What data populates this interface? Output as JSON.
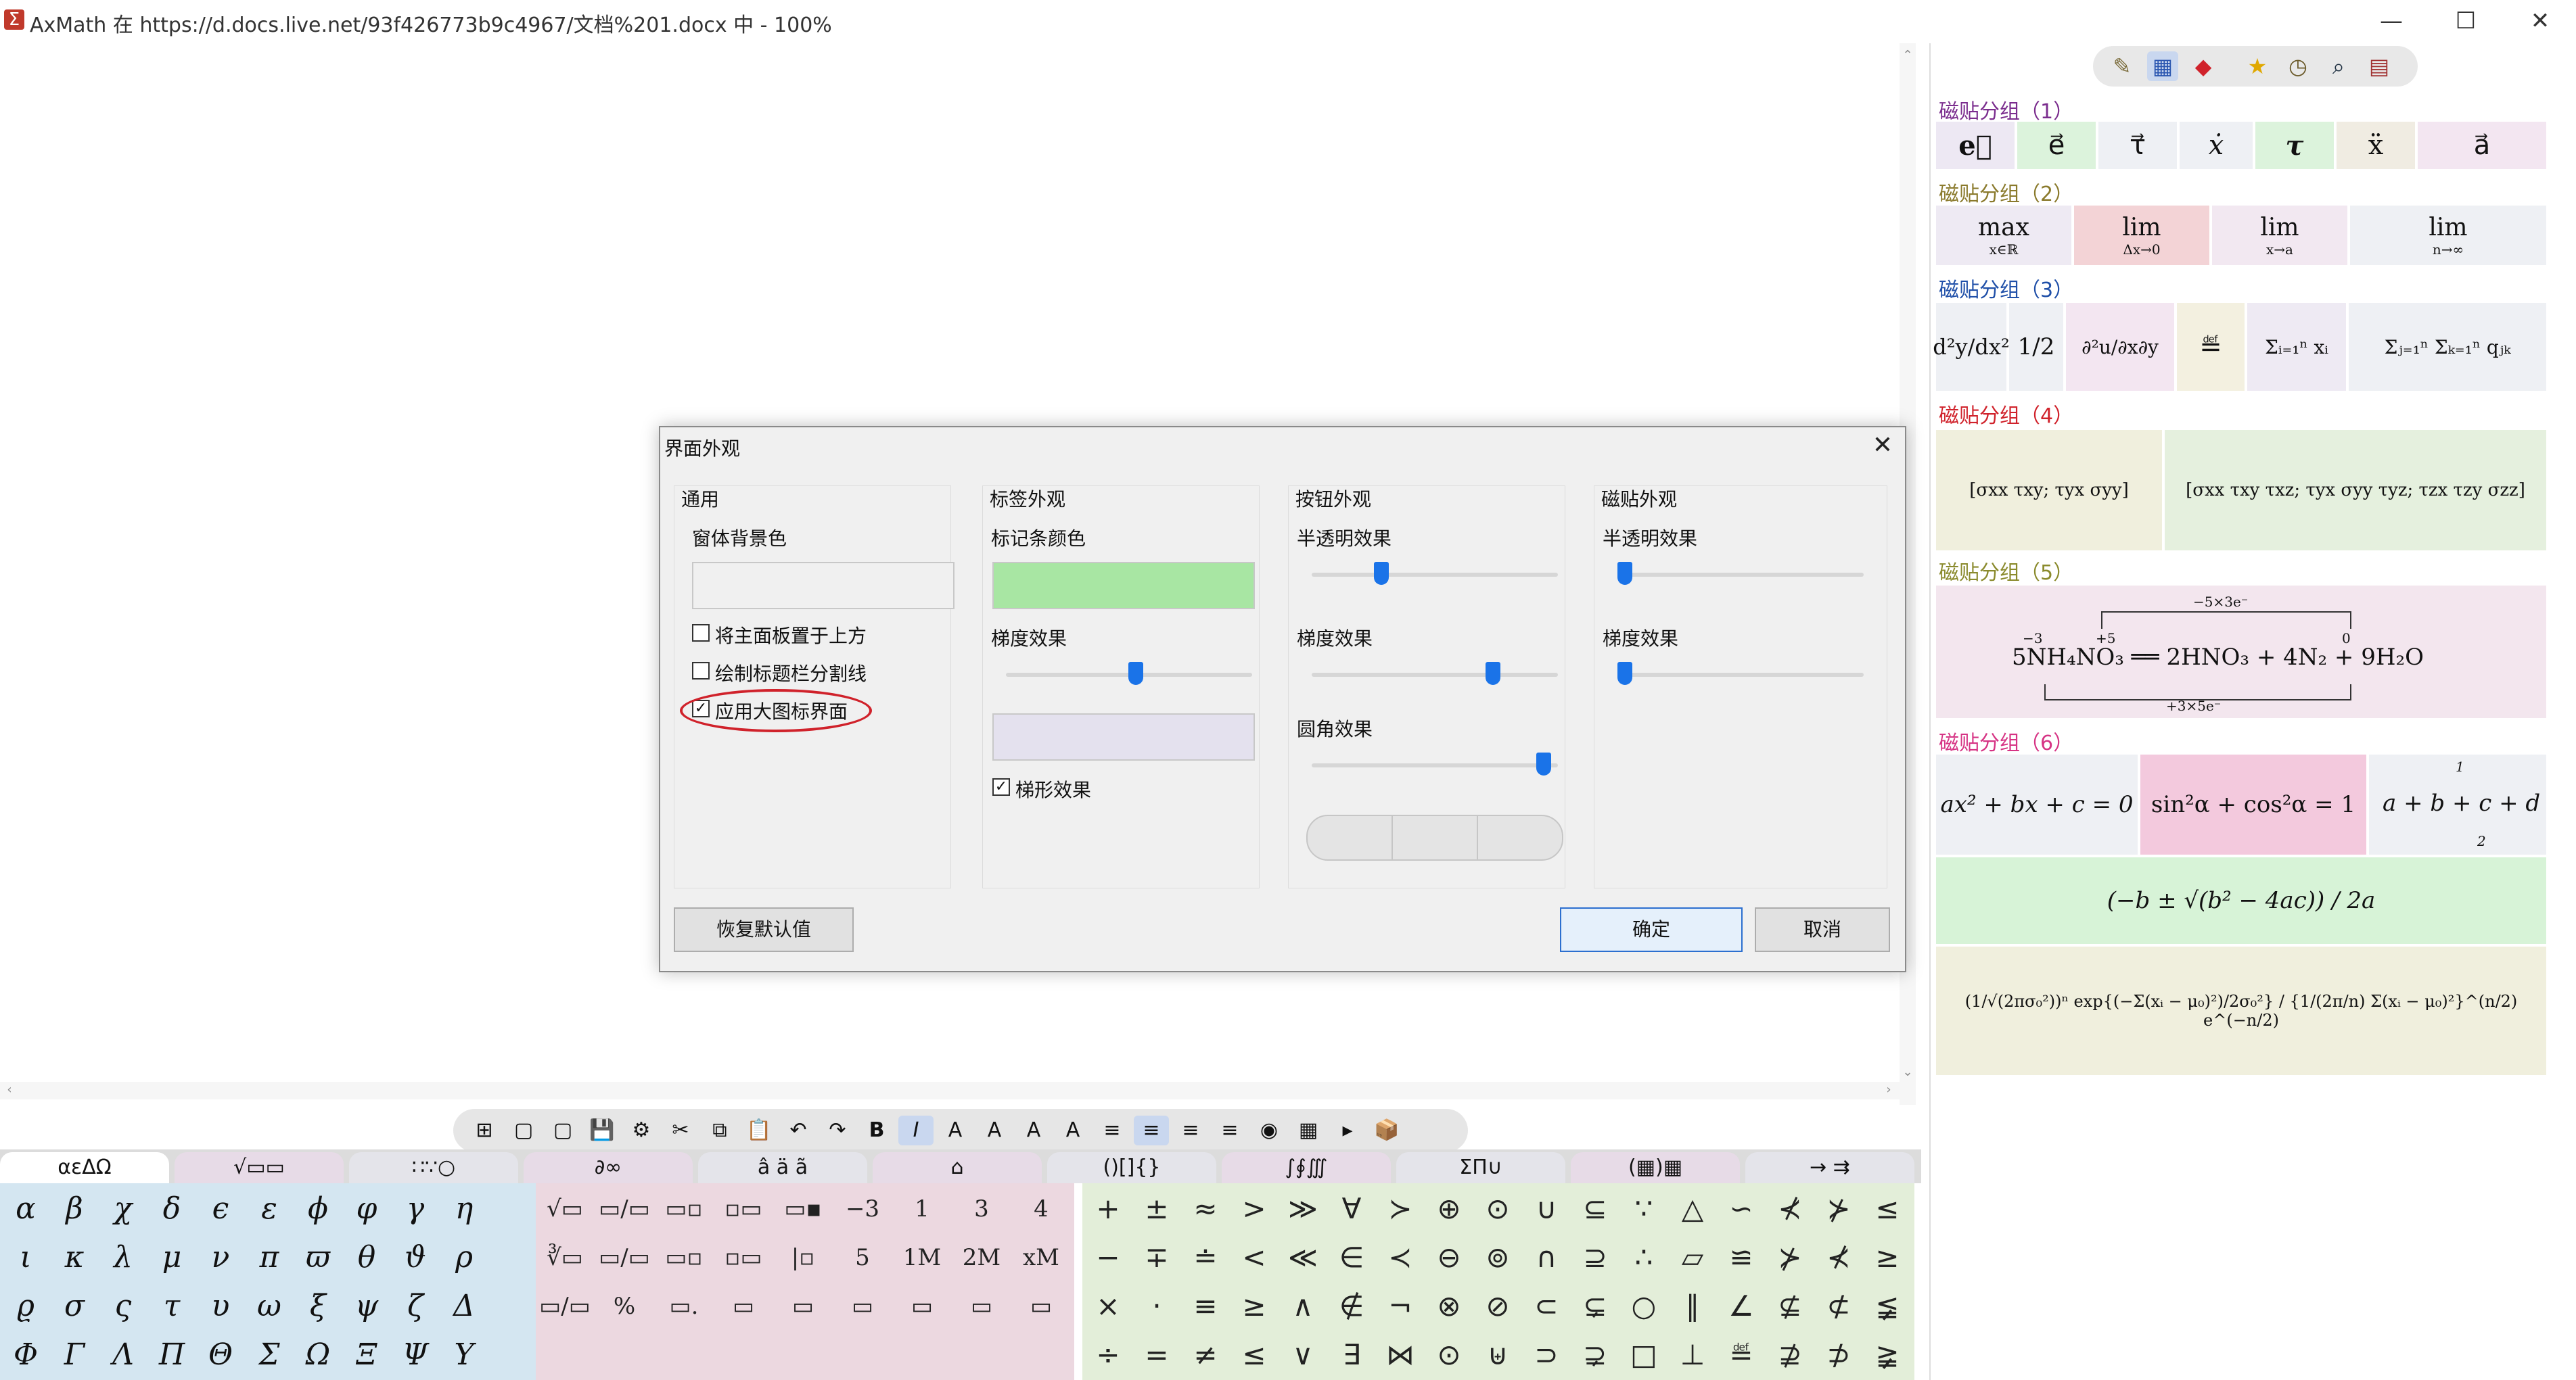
{
  "window": {
    "app_icon": "Σ",
    "title": "AxMath 在 https://d.docs.live.net/93f426773b9c4967/文档%201.docx 中 - 100%",
    "minimize": "—",
    "maximize": "☐",
    "close": "✕"
  },
  "right_panel": {
    "toolbar_icons": [
      "edit-icon",
      "grid-icon",
      "eraser-icon",
      "star-icon",
      "clock-icon",
      "search-icon",
      "books-icon"
    ],
    "groups": [
      {
        "title": "磁贴分组（1）",
        "color": "#7b2d8e",
        "tiles": [
          "e⃗",
          "e⃗",
          "τ⃗",
          "ẋ",
          "τ",
          "ẍ",
          "a⃗"
        ]
      },
      {
        "title": "磁贴分组（2）",
        "color": "#8a7a2c",
        "tiles": [
          {
            "main": "max",
            "sub": "x∈ℝ"
          },
          {
            "main": "lim",
            "sub": "Δx→0"
          },
          {
            "main": "lim",
            "sub": "x→a"
          },
          {
            "main": "lim",
            "sub": "n→∞"
          }
        ]
      },
      {
        "title": "磁贴分组（3）",
        "color": "#1f4fa8",
        "tiles": [
          "d²y/dx²",
          "1/2",
          "∂²u/∂x∂y",
          "≝",
          "Σᵢ₌₁ⁿ xᵢ",
          "Σⱼ₌₁ⁿ Σₖ₌₁ⁿ qⱼₖ"
        ]
      },
      {
        "title": "磁贴分组（4）",
        "color": "#d0222b",
        "tiles": [
          "[σxx τxy; τyx σyy]",
          "[σxx τxy τxz; τyx σyy τyz; τzx τzy σzz]"
        ]
      },
      {
        "title": "磁贴分组（5）",
        "color": "#8a8a2c",
        "tiles": [
          "5NH₄NO₃ ══ 2HNO₃ + 4N₂ + 9H₂O"
        ],
        "annotations": {
          "top": "−5×3e⁻",
          "bottom": "+3×5e⁻",
          "ox1": "−3",
          "ox2": "+5",
          "ox3": "0"
        }
      },
      {
        "title": "磁贴分组（6）",
        "color": "#d63384",
        "tiles": [
          "ax² + bx + c = 0",
          "sin²α + cos²α = 1",
          "a + b + c + d",
          "(−b ± √(b² − 4ac)) / 2a",
          "(1/√(2πσ₀²))ⁿ exp{(−Σ(xᵢ − μ₀)²)/2σ₀²} / {1/(2π/n) Σ(xᵢ − μ₀)²}^(n/2) e^(−n/2)"
        ],
        "brace_labels": {
          "top": "1",
          "bottom": "2"
        }
      }
    ]
  },
  "dialog": {
    "title": "界面外观",
    "close": "✕",
    "sections": {
      "general": {
        "title": "通用",
        "bg_label": "窗体背景色",
        "checkboxes": [
          {
            "label": "将主面板置于上方",
            "checked": false
          },
          {
            "label": "绘制标题栏分割线",
            "checked": false
          },
          {
            "label": "应用大图标界面",
            "checked": true
          }
        ]
      },
      "tab": {
        "title": "标签外观",
        "color_label": "标记条颜色",
        "color": "#a8e6a3",
        "gradient_label": "梯度效果",
        "gradient_value": 0.53,
        "swatch2": "#e4e1ee",
        "checkbox": {
          "label": "梯形效果",
          "checked": true
        }
      },
      "button": {
        "title": "按钮外观",
        "opacity_label": "半透明效果",
        "opacity_value": 0.27,
        "gradient_label": "梯度效果",
        "gradient_value": 0.75,
        "radius_label": "圆角效果",
        "radius_value": 0.97
      },
      "tile": {
        "title": "磁贴外观",
        "opacity_label": "半透明效果",
        "opacity_value": 0.0,
        "gradient_label": "梯度效果",
        "gradient_value": 0.0
      }
    },
    "reset_button": "恢复默认值",
    "ok_button": "确定",
    "cancel_button": "取消"
  },
  "bottom_toolbar": {
    "buttons": [
      "⊞",
      "▢",
      "▢",
      "💾",
      "⚙",
      "✂",
      "⧉",
      "📋",
      "↶",
      "↷",
      "B",
      "I",
      "A",
      "A",
      "A",
      "A",
      "≡",
      "≡",
      "≡",
      "≡",
      "◉",
      "▦",
      "▸",
      "📦"
    ]
  },
  "tabs": [
    "αεΔΩ",
    "√▭▭",
    "∷∵○",
    "∂∞",
    "â ä ã",
    "⌂",
    "()[]{}",
    "∫∮∭",
    "ΣΠ∪",
    "(▦)▦",
    "→ ⇉"
  ],
  "greek_keys": [
    [
      "α",
      "β",
      "χ",
      "δ",
      "ϵ",
      "ε",
      "ϕ",
      "φ",
      "γ",
      "η"
    ],
    [
      "ι",
      "κ",
      "λ",
      "μ",
      "ν",
      "π",
      "ϖ",
      "θ",
      "ϑ",
      "ρ"
    ],
    [
      "ϱ",
      "σ",
      "ς",
      "τ",
      "υ",
      "ω",
      "ξ",
      "ψ",
      "ζ",
      "Δ"
    ],
    [
      "Φ",
      "Γ",
      "Λ",
      "Π",
      "Θ",
      "Σ",
      "Ω",
      "Ξ",
      "Ψ",
      "Υ"
    ]
  ],
  "struct_keys": [
    [
      "√▭",
      "▭/▭",
      "▭▫",
      "▫▭",
      "▭▪",
      "−3",
      "1",
      "3",
      "4"
    ],
    [
      "∛▭",
      "▭/▭",
      "▭▫",
      "▫▭",
      "|▫",
      "5",
      "1M",
      "2M",
      "xM"
    ],
    [
      "▭/▭",
      "%",
      "▭.",
      "▭",
      "▭",
      "▭",
      "▭",
      "▭",
      "▭"
    ]
  ],
  "ops_keys": [
    [
      "+",
      "±",
      "≈",
      ">",
      "≫",
      "∀",
      "≻",
      "⊕",
      "⊙",
      "∪",
      "⊆",
      "∵",
      "△",
      "∽",
      "⊀",
      "⊁",
      "≤"
    ],
    [
      "−",
      "∓",
      "≐",
      "<",
      "≪",
      "∈",
      "≺",
      "⊖",
      "⊚",
      "∩",
      "⊇",
      "∴",
      "▱",
      "≌",
      "⊁",
      "⊀",
      "≥"
    ],
    [
      "×",
      "·",
      "≡",
      "≥",
      "∧",
      "∉",
      "¬",
      "⊗",
      "⊘",
      "⊂",
      "⊊",
      "○",
      "∥",
      "∠",
      "⊈",
      "⊄",
      "≨"
    ],
    [
      "÷",
      "=",
      "≠",
      "≤",
      "∨",
      "∃",
      "⋈",
      "⊙",
      "⊎",
      "⊃",
      "⊋",
      "□",
      "⊥",
      "≝",
      "⊉",
      "⊅",
      "≩"
    ]
  ]
}
